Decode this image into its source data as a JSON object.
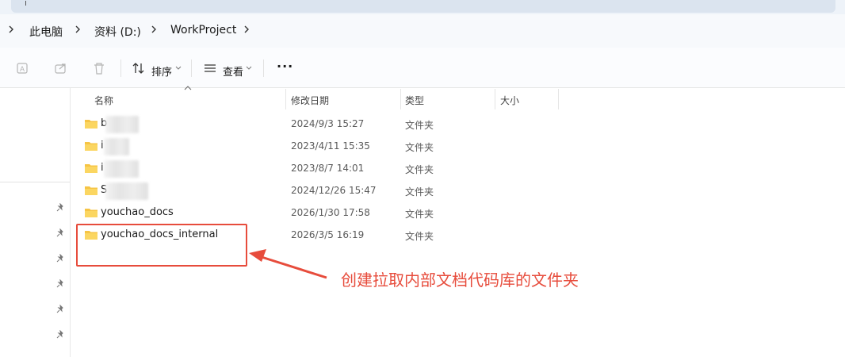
{
  "breadcrumb": {
    "items": [
      "此电脑",
      "资料 (D:)",
      "WorkProject"
    ]
  },
  "toolbar": {
    "sort_label": "排序",
    "view_label": "查看",
    "more_label": "···"
  },
  "columns": {
    "name": "名称",
    "modified": "修改日期",
    "type": "类型",
    "size": "大小"
  },
  "files": [
    {
      "name": "b",
      "modified": "2024/9/3 15:27",
      "type": "文件夹"
    },
    {
      "name": "i",
      "modified": "2023/4/11 15:35",
      "type": "文件夹"
    },
    {
      "name": "i",
      "modified": "2023/8/7 14:01",
      "type": "文件夹"
    },
    {
      "name": "S",
      "modified": "2024/12/26 15:47",
      "type": "文件夹"
    },
    {
      "name": "youchao_docs",
      "modified": "2026/1/30 17:58",
      "type": "文件夹"
    },
    {
      "name": "youchao_docs_internal",
      "modified": "2026/3/5 16:19",
      "type": "文件夹"
    }
  ],
  "annotation": {
    "text": "创建拉取内部文档代码库的文件夹",
    "color": "#e74c3c"
  },
  "colors": {
    "folder": "#f6c445",
    "accent_red": "#e74c3c"
  }
}
